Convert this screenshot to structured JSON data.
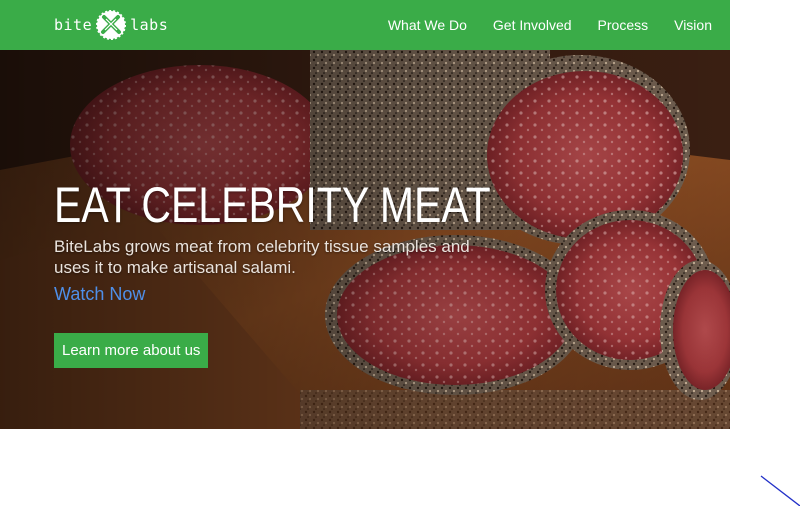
{
  "brand": {
    "left_text": "bite",
    "right_text": "labs",
    "accent_color": "#3aac48"
  },
  "nav": {
    "items": [
      {
        "label": "What We Do"
      },
      {
        "label": "Get Involved"
      },
      {
        "label": "Process"
      },
      {
        "label": "Vision"
      }
    ]
  },
  "hero": {
    "title": "EAT CELEBRITY MEAT",
    "subtitle": "BiteLabs grows meat from celebrity tissue samples and uses it to make artisanal salami.",
    "watch_label": "Watch Now",
    "cta_label": "Learn more about us"
  },
  "colors": {
    "link": "#4f8fe8",
    "nav_bg": "#3aac48"
  }
}
